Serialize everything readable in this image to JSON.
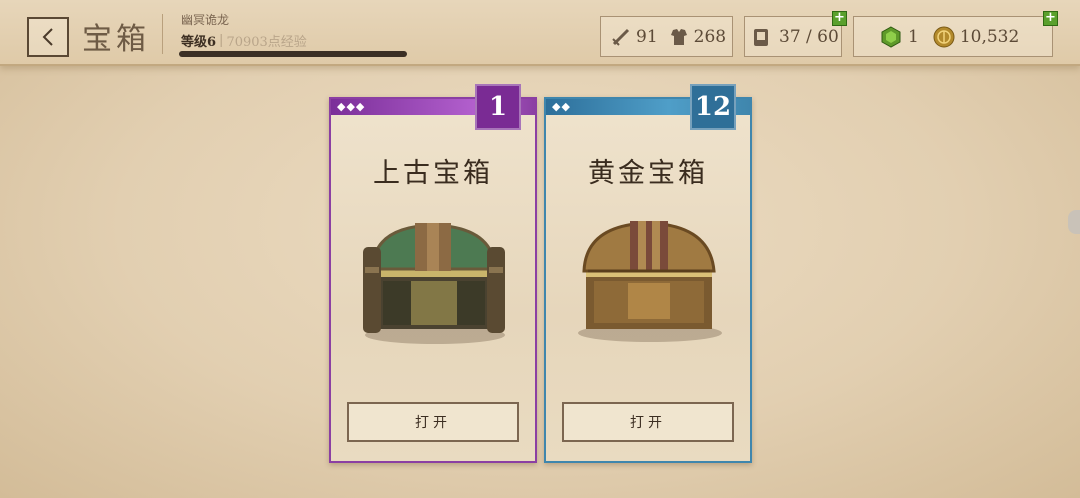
{
  "header": {
    "title": "宝箱",
    "player_name": "幽冥诡龙",
    "level_label": "等级6",
    "level_separator": "|",
    "xp_text": "70903点经验"
  },
  "stats": {
    "attack": "91",
    "health": "268",
    "cards": "37 / 60",
    "gems": "1",
    "gold": "10,532"
  },
  "cards": [
    {
      "rarity": "◆◆◆",
      "count": "1",
      "title": "上古宝箱",
      "button": "打开",
      "color": "#8b3fa3"
    },
    {
      "rarity": "◆◆",
      "count": "12",
      "title": "黄金宝箱",
      "button": "打开",
      "color": "#3f86ad"
    }
  ],
  "icons": {
    "back": "chevron-left-icon",
    "attack": "sword-icon",
    "health": "armor-icon",
    "cards": "deck-icon",
    "gems": "gem-icon",
    "gold": "gold-coin-icon",
    "plus": "plus-icon"
  },
  "colors": {
    "purple": "#8b3fa3",
    "blue": "#3f86ad",
    "plus_green": "#5aa02c"
  },
  "plus_symbol": "+"
}
